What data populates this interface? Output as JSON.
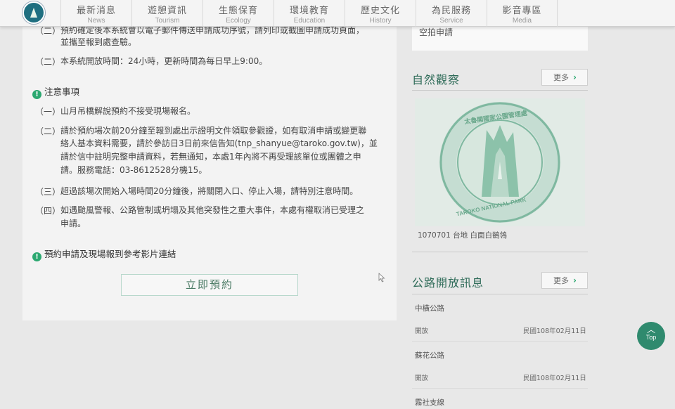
{
  "nav": {
    "items": [
      {
        "zh": "最新消息",
        "en": "News"
      },
      {
        "zh": "遊憩資訊",
        "en": "Tourism"
      },
      {
        "zh": "生態保育",
        "en": "Ecology"
      },
      {
        "zh": "環境教育",
        "en": "Education"
      },
      {
        "zh": "歷史文化",
        "en": "History"
      },
      {
        "zh": "為民服務",
        "en": "Service"
      },
      {
        "zh": "影音專區",
        "en": "Media"
      }
    ]
  },
  "main": {
    "partial_lines": [
      {
        "num": "（二）",
        "text": "預約確定後本系統會以電子郵件傳送申請成功序號，請列印或截圖申請成功頁面，"
      },
      {
        "num": "",
        "text": "並攜至報到處查驗。"
      },
      {
        "num": "（二）",
        "text": "本系統開放時間：24小時，更新時間為每日早上9:00。"
      }
    ],
    "notice_heading": "注意事項",
    "notice_items": [
      {
        "num": "（一）",
        "lines": [
          "山月吊橋解說預約不接受現場報名。"
        ]
      },
      {
        "num": "（二）",
        "lines": [
          "請於預約場次前20分鐘至報到處出示證明文件領取參觀證，如有取消申請或變更聯",
          "絡人基本資料需要，請於參訪日3日前來信告知(tnp_shanyue@taroko.gov.tw)，並",
          "請於信中註明完整申請資料，若無通知，本處1年內將不再受理該單位或團體之申",
          "請。服務電話：03-8612528分機15。"
        ]
      },
      {
        "num": "（三）",
        "lines": [
          "超過該場次開始入場時間20分鐘後，將關閉入口、停止入場，請特別注意時間。"
        ]
      },
      {
        "num": "（四）",
        "lines": [
          "如遇颱風警報、公路管制或坍塌及其他突發性之重大事件，本處有權取消已受理之",
          "申請。"
        ]
      }
    ],
    "video_link": "預約申請及現場報到參考影片連結",
    "reserve_button": "立即預約"
  },
  "sidebar": {
    "top_item": "空拍申請",
    "nature": {
      "title": "自然觀察",
      "more": "更多",
      "photo_text_top": "太魯閣國家公園管理處",
      "photo_text_bottom": "TAROKO NATIONAL PARK",
      "caption": "1070701 台地 白面白鶺鴒"
    },
    "roads": {
      "title": "公路開放訊息",
      "more": "更多",
      "items": [
        {
          "name": "中橫公路",
          "status": "開放",
          "date": "民國108年02月11日"
        },
        {
          "name": "蘇花公路",
          "status": "開放",
          "date": "民國108年02月11日"
        },
        {
          "name": "霧社支線"
        }
      ]
    }
  },
  "top_button": "Top",
  "colors": {
    "accent": "#2ba870",
    "title": "#2e6b58",
    "top_button": "#2f8a6e"
  }
}
